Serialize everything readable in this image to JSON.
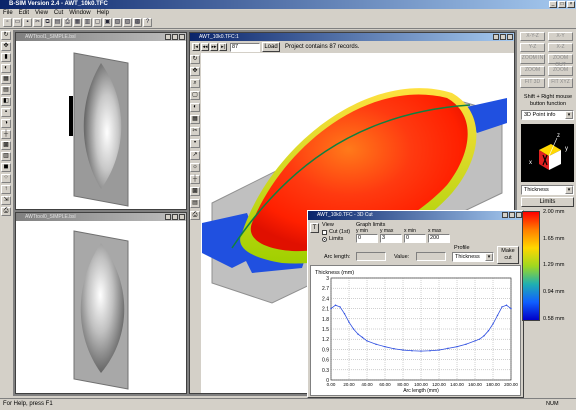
{
  "app": {
    "title": "B-SIM Version 2.4 - AWT_10k0.TFC"
  },
  "menu": [
    "File",
    "Edit",
    "View",
    "Cut",
    "Window",
    "Help"
  ],
  "windows": {
    "top_left": "AWTtool1_SIMPLE.bsl",
    "bottom_left": "AWTtool0_SIMPLE.bsl",
    "main": "AWT_10k0.TFC:1"
  },
  "nav": {
    "record": "87",
    "load": "Load",
    "status": "Project contains 87 records."
  },
  "panel": {
    "buttons": [
      "X-Y-Z",
      "X-Y",
      "Y-Z",
      "X-Z",
      "ZOOM IN",
      "ZOOM OUT",
      "ZOOM",
      "ZOOM",
      "FIT 3D",
      "FIT XYZ"
    ],
    "hint": "Shift + Right mouse button function",
    "mode": "3D Point info",
    "axes": {
      "z": "z",
      "y": "y",
      "x": "x"
    },
    "variable": "Thickness",
    "limits": "Limits"
  },
  "legend": {
    "colors": [
      "#ff0000",
      "#ff7f00",
      "#ffd700",
      "#a0d820",
      "#20b0b0",
      "#1060ff",
      "#0000c8"
    ],
    "values": [
      "2.00 mm",
      "1.65 mm",
      "1.29 mm",
      "0.94 mm",
      "0.58 mm"
    ]
  },
  "cut": {
    "title": "AWT_10k0.TFC - 3D Cut",
    "view_label": "View",
    "opt_cut": "Cut (1st)",
    "opt_limits": "Limits",
    "graph_limits": "Graph limits",
    "lim_labels": [
      "y min",
      "y max",
      "x min",
      "x max"
    ],
    "lim_values": [
      "0",
      "3",
      "0",
      "200"
    ],
    "profile_label": "Profile",
    "profile": "Thickness",
    "make_cut": "Make cut",
    "arc_label": "Arc length:",
    "value_label": "Value:",
    "chart_title": "Thickness (mm)"
  },
  "chart_data": {
    "type": "line",
    "title": "Thickness (mm)",
    "xlabel": "Arc length (mm)",
    "ylabel": "",
    "xlim": [
      0,
      200
    ],
    "ylim": [
      0,
      3
    ],
    "xticks": [
      "0.00",
      "20.00",
      "40.00",
      "60.00",
      "80.00",
      "100.00",
      "120.00",
      "140.00",
      "160.00",
      "180.00",
      "200.00"
    ],
    "yticks": [
      "3",
      "2.7",
      "2.4",
      "2.1",
      "1.8",
      "1.5",
      "1.2",
      "0.9",
      "0.6",
      "0.3",
      "0"
    ],
    "grid": true,
    "x": [
      0,
      5,
      10,
      15,
      20,
      25,
      30,
      35,
      40,
      50,
      60,
      70,
      80,
      90,
      100,
      110,
      120,
      130,
      140,
      150,
      160,
      165,
      170,
      175,
      180,
      185,
      190,
      195,
      200
    ],
    "y": [
      2.1,
      2.2,
      2.15,
      1.95,
      1.7,
      1.5,
      1.35,
      1.25,
      1.15,
      1.05,
      0.98,
      0.92,
      0.88,
      0.86,
      0.85,
      0.86,
      0.88,
      0.93,
      0.98,
      1.05,
      1.15,
      1.2,
      1.3,
      1.45,
      1.65,
      1.9,
      2.15,
      2.2,
      2.1
    ],
    "color": "#3050e0"
  },
  "status": {
    "help": "For Help, press F1",
    "num": "NUM"
  }
}
